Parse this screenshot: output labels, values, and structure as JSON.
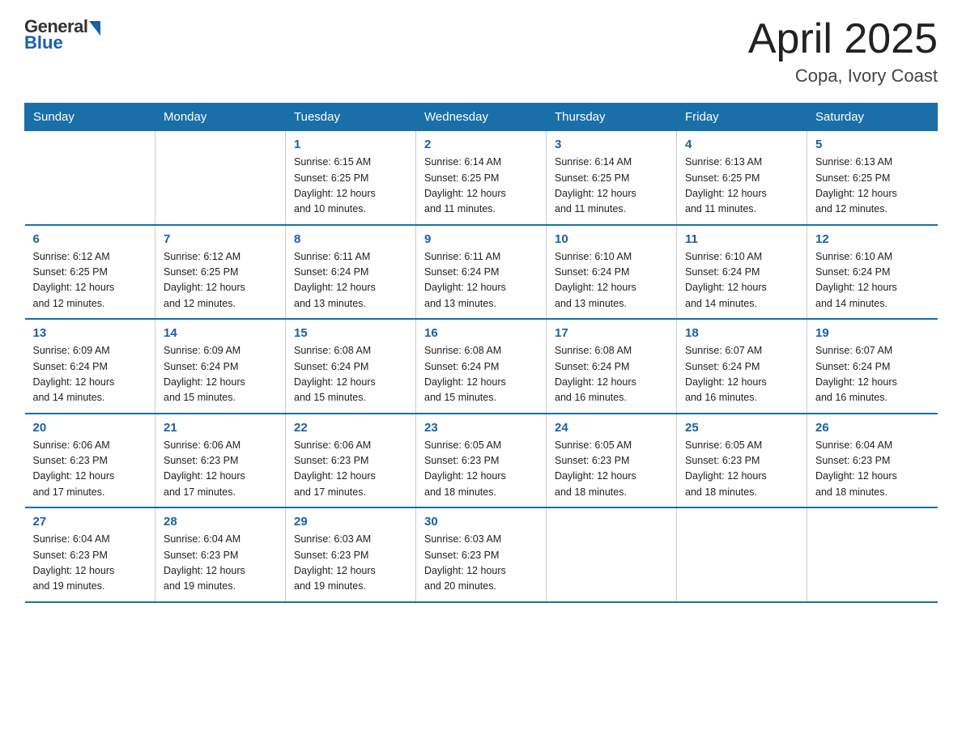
{
  "header": {
    "logo_general": "General",
    "logo_blue": "Blue",
    "title": "April 2025",
    "location": "Copa, Ivory Coast"
  },
  "weekdays": [
    "Sunday",
    "Monday",
    "Tuesday",
    "Wednesday",
    "Thursday",
    "Friday",
    "Saturday"
  ],
  "weeks": [
    [
      {
        "day": "",
        "info": ""
      },
      {
        "day": "",
        "info": ""
      },
      {
        "day": "1",
        "info": "Sunrise: 6:15 AM\nSunset: 6:25 PM\nDaylight: 12 hours\nand 10 minutes."
      },
      {
        "day": "2",
        "info": "Sunrise: 6:14 AM\nSunset: 6:25 PM\nDaylight: 12 hours\nand 11 minutes."
      },
      {
        "day": "3",
        "info": "Sunrise: 6:14 AM\nSunset: 6:25 PM\nDaylight: 12 hours\nand 11 minutes."
      },
      {
        "day": "4",
        "info": "Sunrise: 6:13 AM\nSunset: 6:25 PM\nDaylight: 12 hours\nand 11 minutes."
      },
      {
        "day": "5",
        "info": "Sunrise: 6:13 AM\nSunset: 6:25 PM\nDaylight: 12 hours\nand 12 minutes."
      }
    ],
    [
      {
        "day": "6",
        "info": "Sunrise: 6:12 AM\nSunset: 6:25 PM\nDaylight: 12 hours\nand 12 minutes."
      },
      {
        "day": "7",
        "info": "Sunrise: 6:12 AM\nSunset: 6:25 PM\nDaylight: 12 hours\nand 12 minutes."
      },
      {
        "day": "8",
        "info": "Sunrise: 6:11 AM\nSunset: 6:24 PM\nDaylight: 12 hours\nand 13 minutes."
      },
      {
        "day": "9",
        "info": "Sunrise: 6:11 AM\nSunset: 6:24 PM\nDaylight: 12 hours\nand 13 minutes."
      },
      {
        "day": "10",
        "info": "Sunrise: 6:10 AM\nSunset: 6:24 PM\nDaylight: 12 hours\nand 13 minutes."
      },
      {
        "day": "11",
        "info": "Sunrise: 6:10 AM\nSunset: 6:24 PM\nDaylight: 12 hours\nand 14 minutes."
      },
      {
        "day": "12",
        "info": "Sunrise: 6:10 AM\nSunset: 6:24 PM\nDaylight: 12 hours\nand 14 minutes."
      }
    ],
    [
      {
        "day": "13",
        "info": "Sunrise: 6:09 AM\nSunset: 6:24 PM\nDaylight: 12 hours\nand 14 minutes."
      },
      {
        "day": "14",
        "info": "Sunrise: 6:09 AM\nSunset: 6:24 PM\nDaylight: 12 hours\nand 15 minutes."
      },
      {
        "day": "15",
        "info": "Sunrise: 6:08 AM\nSunset: 6:24 PM\nDaylight: 12 hours\nand 15 minutes."
      },
      {
        "day": "16",
        "info": "Sunrise: 6:08 AM\nSunset: 6:24 PM\nDaylight: 12 hours\nand 15 minutes."
      },
      {
        "day": "17",
        "info": "Sunrise: 6:08 AM\nSunset: 6:24 PM\nDaylight: 12 hours\nand 16 minutes."
      },
      {
        "day": "18",
        "info": "Sunrise: 6:07 AM\nSunset: 6:24 PM\nDaylight: 12 hours\nand 16 minutes."
      },
      {
        "day": "19",
        "info": "Sunrise: 6:07 AM\nSunset: 6:24 PM\nDaylight: 12 hours\nand 16 minutes."
      }
    ],
    [
      {
        "day": "20",
        "info": "Sunrise: 6:06 AM\nSunset: 6:23 PM\nDaylight: 12 hours\nand 17 minutes."
      },
      {
        "day": "21",
        "info": "Sunrise: 6:06 AM\nSunset: 6:23 PM\nDaylight: 12 hours\nand 17 minutes."
      },
      {
        "day": "22",
        "info": "Sunrise: 6:06 AM\nSunset: 6:23 PM\nDaylight: 12 hours\nand 17 minutes."
      },
      {
        "day": "23",
        "info": "Sunrise: 6:05 AM\nSunset: 6:23 PM\nDaylight: 12 hours\nand 18 minutes."
      },
      {
        "day": "24",
        "info": "Sunrise: 6:05 AM\nSunset: 6:23 PM\nDaylight: 12 hours\nand 18 minutes."
      },
      {
        "day": "25",
        "info": "Sunrise: 6:05 AM\nSunset: 6:23 PM\nDaylight: 12 hours\nand 18 minutes."
      },
      {
        "day": "26",
        "info": "Sunrise: 6:04 AM\nSunset: 6:23 PM\nDaylight: 12 hours\nand 18 minutes."
      }
    ],
    [
      {
        "day": "27",
        "info": "Sunrise: 6:04 AM\nSunset: 6:23 PM\nDaylight: 12 hours\nand 19 minutes."
      },
      {
        "day": "28",
        "info": "Sunrise: 6:04 AM\nSunset: 6:23 PM\nDaylight: 12 hours\nand 19 minutes."
      },
      {
        "day": "29",
        "info": "Sunrise: 6:03 AM\nSunset: 6:23 PM\nDaylight: 12 hours\nand 19 minutes."
      },
      {
        "day": "30",
        "info": "Sunrise: 6:03 AM\nSunset: 6:23 PM\nDaylight: 12 hours\nand 20 minutes."
      },
      {
        "day": "",
        "info": ""
      },
      {
        "day": "",
        "info": ""
      },
      {
        "day": "",
        "info": ""
      }
    ]
  ]
}
